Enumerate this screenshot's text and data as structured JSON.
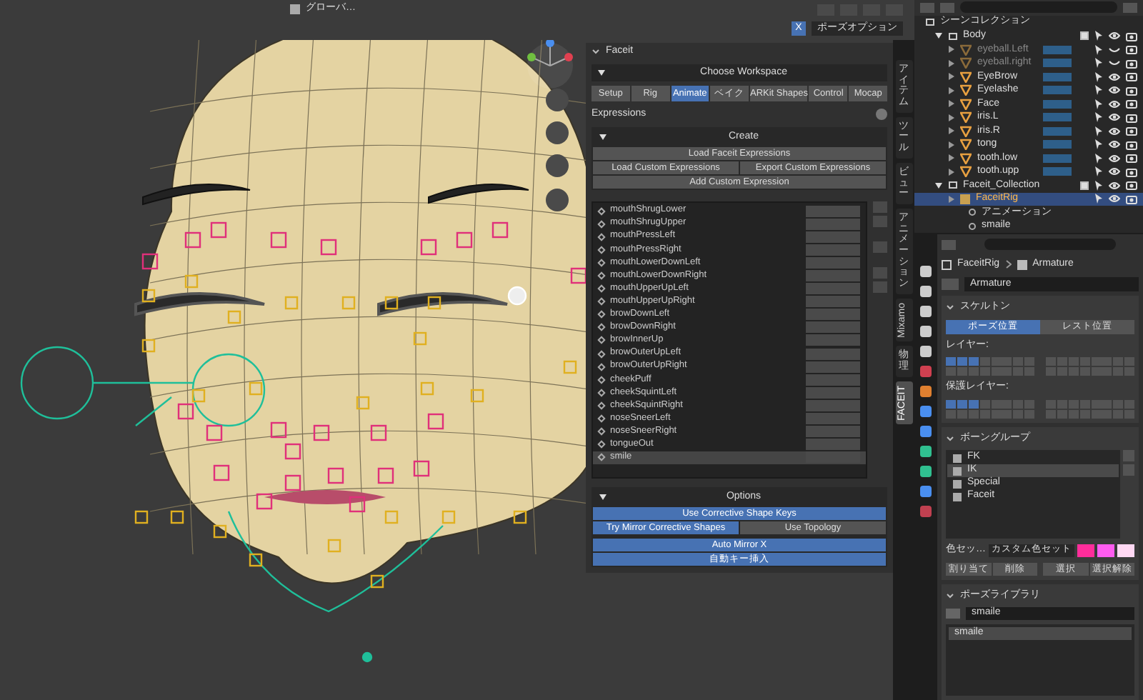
{
  "viewport": {
    "orientation": "グローバ…",
    "x_mirror": {
      "label": "X",
      "on": true
    },
    "pose_options": "ポーズオプション"
  },
  "faceit": {
    "title": "Faceit",
    "workspace_header": "Choose Workspace",
    "workspaces": [
      {
        "label": "Setup",
        "selected": false
      },
      {
        "label": "Rig",
        "selected": false
      },
      {
        "label": "Animate",
        "selected": true
      },
      {
        "label": "ベイク",
        "selected": false
      },
      {
        "label": "ARKit Shapes",
        "selected": false
      },
      {
        "label": "Control",
        "selected": false
      },
      {
        "label": "Mocap",
        "selected": false
      }
    ],
    "section": "Expressions",
    "create_title": "Create",
    "create_rows": [
      [
        "Load Faceit Expressions"
      ],
      [
        "Load Custom Expressions",
        "Export Custom Expressions"
      ],
      [
        "Add Custom Expression"
      ]
    ],
    "expressions": [
      {
        "name": "mouthShrugLower",
        "selected": false
      },
      {
        "name": "mouthShrugUpper",
        "selected": false
      },
      {
        "name": "mouthPressLeft",
        "selected": false
      },
      {
        "name": "mouthPressRight",
        "selected": false
      },
      {
        "name": "mouthLowerDownLeft",
        "selected": false
      },
      {
        "name": "mouthLowerDownRight",
        "selected": false
      },
      {
        "name": "mouthUpperUpLeft",
        "selected": false
      },
      {
        "name": "mouthUpperUpRight",
        "selected": false
      },
      {
        "name": "browDownLeft",
        "selected": false
      },
      {
        "name": "browDownRight",
        "selected": false
      },
      {
        "name": "browInnerUp",
        "selected": false
      },
      {
        "name": "browOuterUpLeft",
        "selected": false
      },
      {
        "name": "browOuterUpRight",
        "selected": false
      },
      {
        "name": "cheekPuff",
        "selected": false
      },
      {
        "name": "cheekSquintLeft",
        "selected": false
      },
      {
        "name": "cheekSquintRight",
        "selected": false
      },
      {
        "name": "noseSneerLeft",
        "selected": false
      },
      {
        "name": "noseSneerRight",
        "selected": false
      },
      {
        "name": "tongueOut",
        "selected": false
      },
      {
        "name": "smile",
        "selected": true
      }
    ],
    "options_title": "Options",
    "options": [
      [
        {
          "label": "Use Corrective Shape Keys",
          "on": true
        }
      ],
      [
        {
          "label": "Try Mirror Corrective Shapes",
          "on": true
        },
        {
          "label": "Use Topology",
          "on": false
        }
      ],
      [
        {
          "label": "Auto Mirror X",
          "on": true
        }
      ],
      [
        {
          "label": "自動キー挿入",
          "on": true
        }
      ]
    ]
  },
  "side_tabs": [
    {
      "label": "アイテム",
      "kind": "cjk",
      "selected": false
    },
    {
      "label": "ツール",
      "kind": "cjk",
      "selected": false
    },
    {
      "label": "ビュー",
      "kind": "cjk",
      "selected": false
    },
    {
      "label": "アニメーション",
      "kind": "cjk",
      "selected": false
    },
    {
      "label": "Mixamo",
      "kind": "latin",
      "selected": false
    },
    {
      "label": "物理",
      "kind": "cjk",
      "selected": false
    },
    {
      "label": "FACEIT",
      "kind": "latin",
      "selected": true
    }
  ],
  "outliner": {
    "root": "シーンコレクション",
    "collections": [
      {
        "name": "Body",
        "checked": true,
        "children": [
          {
            "name": "eyeball.Left",
            "visible": false,
            "selected": false
          },
          {
            "name": "eyeball.right",
            "visible": false,
            "selected": false
          },
          {
            "name": "EyeBrow",
            "visible": true,
            "selected": false
          },
          {
            "name": "Eyelashe",
            "visible": true,
            "selected": false
          },
          {
            "name": "Face",
            "visible": true,
            "selected": false
          },
          {
            "name": "iris.L",
            "visible": true,
            "selected": false
          },
          {
            "name": "iris.R",
            "visible": true,
            "selected": false
          },
          {
            "name": "tong",
            "visible": true,
            "selected": false
          },
          {
            "name": "tooth.low",
            "visible": true,
            "selected": false
          },
          {
            "name": "tooth.upp",
            "visible": true,
            "selected": false
          }
        ]
      },
      {
        "name": "Faceit_Collection",
        "checked": true,
        "children": [
          {
            "name": "FaceitRig",
            "visible": true,
            "selected": true
          }
        ]
      }
    ],
    "rig_children": [
      "アニメーション",
      "smaile"
    ]
  },
  "properties": {
    "breadcrumb": [
      "FaceitRig",
      "Armature"
    ],
    "data_name": "Armature",
    "skeleton_title": "スケルトン",
    "positions": [
      {
        "label": "ポーズ位置",
        "selected": true
      },
      {
        "label": "レスト位置",
        "selected": false
      }
    ],
    "layers_label": "レイヤー:",
    "protected_label": "保護レイヤー:",
    "bone_groups_title": "ボーングループ",
    "bone_groups": [
      {
        "name": "FK",
        "selected": false
      },
      {
        "name": "IK",
        "selected": true
      },
      {
        "name": "Special",
        "selected": false
      },
      {
        "name": "Faceit",
        "selected": false
      }
    ],
    "color_set_label": "色セッ…",
    "color_set": "カスタム色セット",
    "swatches": [
      {
        "color": "#ff2d9b"
      },
      {
        "color": "#ff5cf0"
      },
      {
        "color": "#ffd8f3"
      }
    ],
    "group_buttons": [
      "割り当て",
      "削除",
      "選択",
      "選択解除"
    ],
    "pose_library_title": "ポーズライブラリ",
    "pose_library_name": "smaile",
    "poses": [
      {
        "name": "smaile",
        "selected": true
      }
    ]
  }
}
